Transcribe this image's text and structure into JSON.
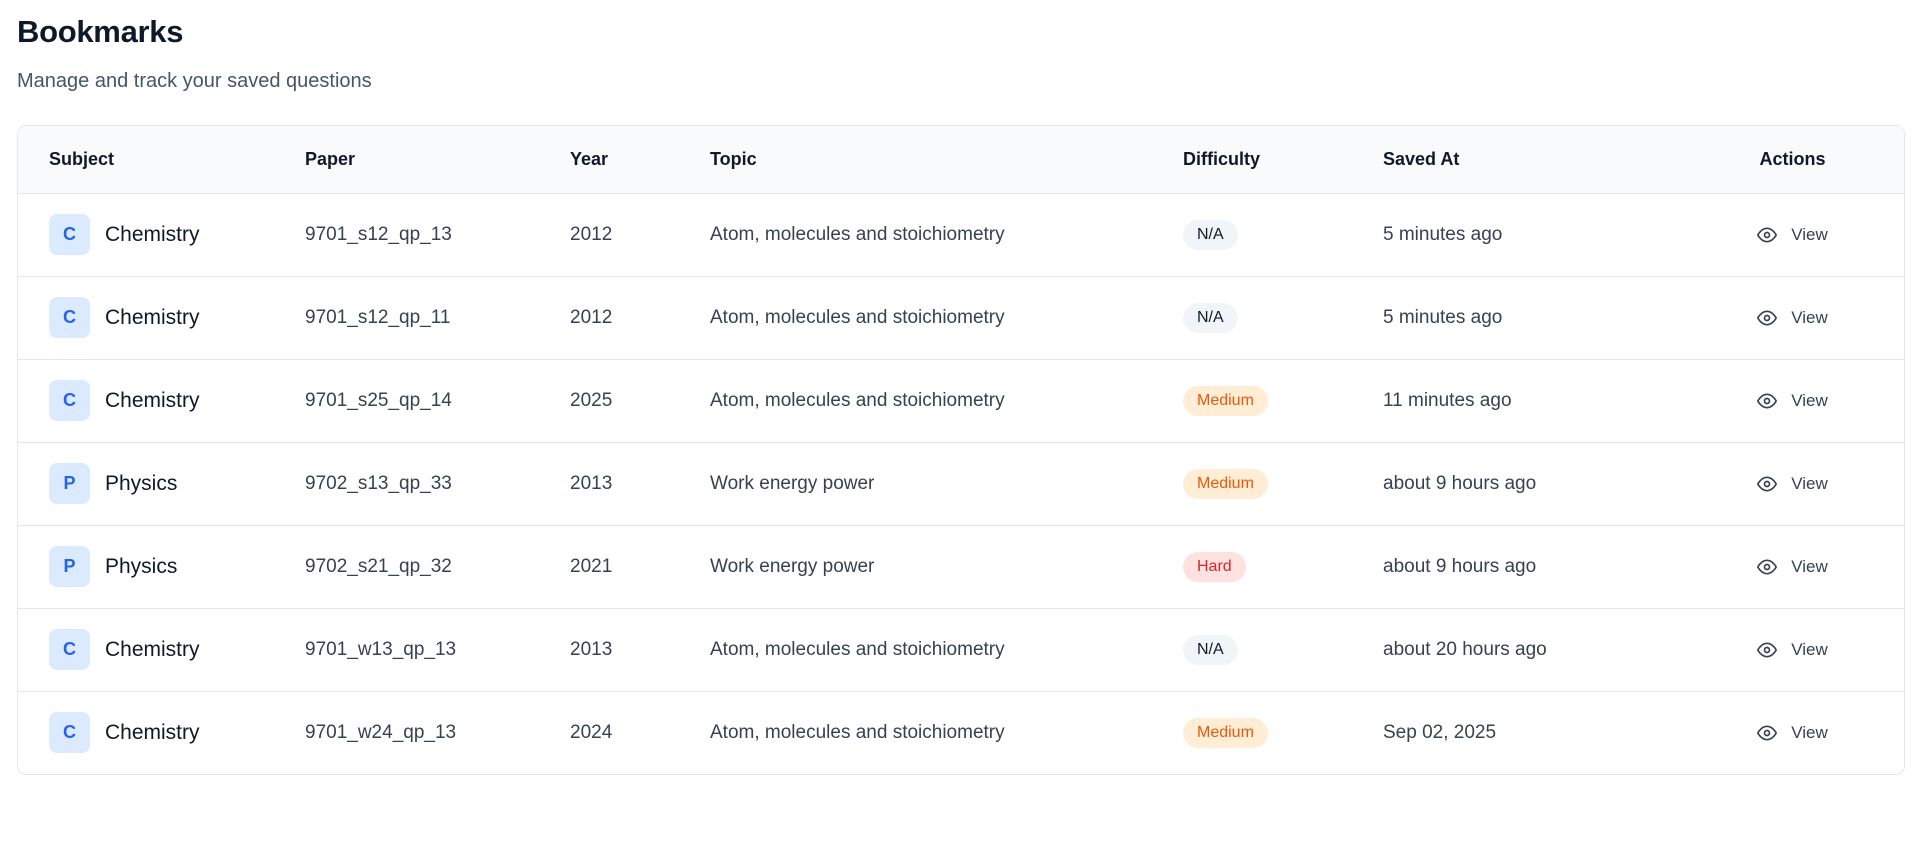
{
  "page": {
    "title": "Bookmarks",
    "subtitle": "Manage and track your saved questions"
  },
  "table": {
    "headers": {
      "subject": "Subject",
      "paper": "Paper",
      "year": "Year",
      "topic": "Topic",
      "difficulty": "Difficulty",
      "saved_at": "Saved At",
      "actions": "Actions"
    },
    "view_label": "View",
    "rows": [
      {
        "initial": "C",
        "subject": "Chemistry",
        "paper": "9701_s12_qp_13",
        "year": "2012",
        "topic": "Atom, molecules and stoichiometry",
        "difficulty": "N/A",
        "difficulty_level": "na",
        "saved_at": "5 minutes ago"
      },
      {
        "initial": "C",
        "subject": "Chemistry",
        "paper": "9701_s12_qp_11",
        "year": "2012",
        "topic": "Atom, molecules and stoichiometry",
        "difficulty": "N/A",
        "difficulty_level": "na",
        "saved_at": "5 minutes ago"
      },
      {
        "initial": "C",
        "subject": "Chemistry",
        "paper": "9701_s25_qp_14",
        "year": "2025",
        "topic": "Atom, molecules and stoichiometry",
        "difficulty": "Medium",
        "difficulty_level": "medium",
        "saved_at": "11 minutes ago"
      },
      {
        "initial": "P",
        "subject": "Physics",
        "paper": "9702_s13_qp_33",
        "year": "2013",
        "topic": "Work energy power",
        "difficulty": "Medium",
        "difficulty_level": "medium",
        "saved_at": "about 9 hours ago"
      },
      {
        "initial": "P",
        "subject": "Physics",
        "paper": "9702_s21_qp_32",
        "year": "2021",
        "topic": "Work energy power",
        "difficulty": "Hard",
        "difficulty_level": "hard",
        "saved_at": "about 9 hours ago"
      },
      {
        "initial": "C",
        "subject": "Chemistry",
        "paper": "9701_w13_qp_13",
        "year": "2013",
        "topic": "Atom, molecules and stoichiometry",
        "difficulty": "N/A",
        "difficulty_level": "na",
        "saved_at": "about 20 hours ago"
      },
      {
        "initial": "C",
        "subject": "Chemistry",
        "paper": "9701_w24_qp_13",
        "year": "2024",
        "topic": "Atom, molecules and stoichiometry",
        "difficulty": "Medium",
        "difficulty_level": "medium",
        "saved_at": "Sep 02, 2025"
      }
    ]
  },
  "colors": {
    "avatar_bg": "#dbeafe",
    "avatar_text": "#2563eb",
    "medium_bg": "#ffedd5",
    "medium_text": "#ea580c",
    "hard_bg": "#fee2e2",
    "hard_text": "#dc2626",
    "na_bg": "#f1f5f9"
  },
  "icons": {
    "view": "eye-icon"
  }
}
